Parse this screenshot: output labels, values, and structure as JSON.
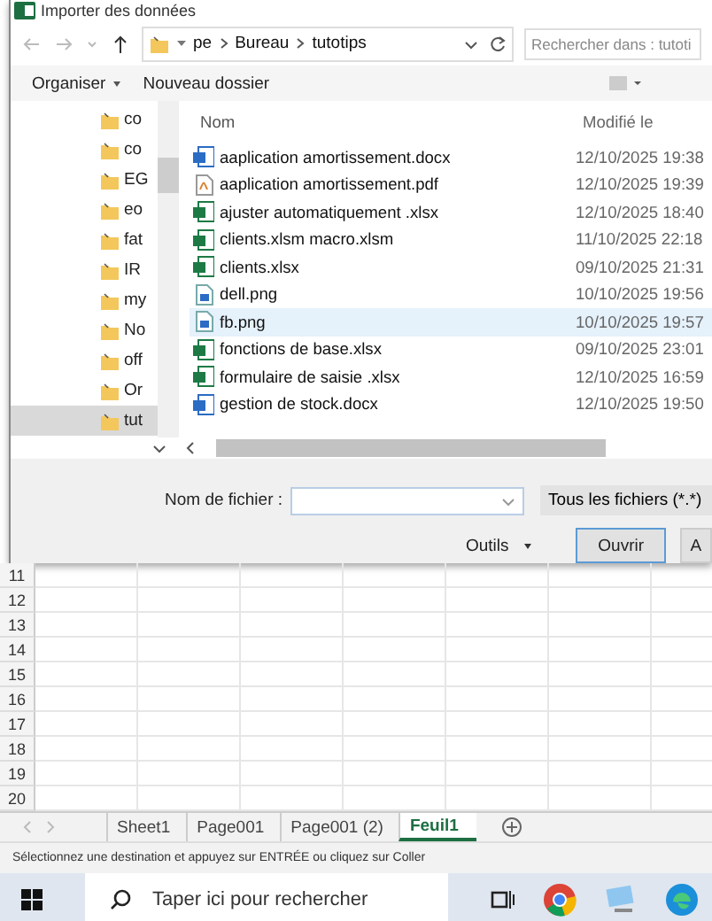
{
  "dialog": {
    "title": "Importer des données",
    "path": [
      "pe",
      "Bureau",
      "tutotips"
    ],
    "search": {
      "placeholder": "Rechercher dans : tutoti"
    },
    "toolbar": {
      "organize": "Organiser",
      "new_folder": "Nouveau dossier"
    },
    "nav_items": [
      {
        "label": "co",
        "selected": false
      },
      {
        "label": "co",
        "selected": false
      },
      {
        "label": "EG",
        "selected": false
      },
      {
        "label": "eo",
        "selected": false
      },
      {
        "label": "fat",
        "selected": false
      },
      {
        "label": "IR",
        "selected": false
      },
      {
        "label": "my",
        "selected": false
      },
      {
        "label": "No",
        "selected": false
      },
      {
        "label": "off",
        "selected": false
      },
      {
        "label": "Or",
        "selected": false
      },
      {
        "label": "tut",
        "selected": true
      }
    ],
    "columns": [
      "Nom",
      "Modifié le"
    ],
    "files": [
      {
        "name": "aaplication amortissement.docx",
        "modified": "12/10/2025 19:38",
        "kind": "word",
        "selected": false
      },
      {
        "name": "aaplication amortissement.pdf",
        "modified": "12/10/2025 19:39",
        "kind": "pdf",
        "selected": false
      },
      {
        "name": "ajuster automatiquement .xlsx",
        "modified": "12/10/2025 18:40",
        "kind": "excel",
        "selected": false
      },
      {
        "name": "clients.xlsm macro.xlsm",
        "modified": "11/10/2025 22:18",
        "kind": "excel",
        "selected": false
      },
      {
        "name": "clients.xlsx",
        "modified": "09/10/2025 21:31",
        "kind": "excel",
        "selected": false
      },
      {
        "name": "dell.png",
        "modified": "10/10/2025 19:56",
        "kind": "image",
        "selected": false
      },
      {
        "name": "fb.png",
        "modified": "10/10/2025 19:57",
        "kind": "image",
        "selected": true
      },
      {
        "name": "fonctions de base.xlsx",
        "modified": "09/10/2025 23:01",
        "kind": "excel",
        "selected": false
      },
      {
        "name": "formulaire de saisie .xlsx",
        "modified": "12/10/2025 16:59",
        "kind": "excel",
        "selected": false
      },
      {
        "name": "gestion de stock.docx",
        "modified": "12/10/2025 19:50",
        "kind": "word",
        "selected": false
      }
    ],
    "filename_label": "Nom de fichier :",
    "file_type": "Tous les fichiers (*.*)",
    "tools": "Outils",
    "open": "Ouvrir",
    "cancel": "A"
  },
  "sheet": {
    "rows": [
      "11",
      "12",
      "13",
      "14",
      "15",
      "16",
      "17",
      "18",
      "19",
      "20"
    ]
  },
  "sheet_tabs": [
    {
      "label": "Sheet1",
      "selected": false
    },
    {
      "label": "Page001",
      "selected": false
    },
    {
      "label": "Page001 (2)",
      "selected": false
    },
    {
      "label": "Feuil1",
      "selected": true
    }
  ],
  "status_bar": "Sélectionnez une destination et appuyez sur ENTRÉE ou cliquez sur Coller",
  "taskbar": {
    "search": {
      "placeholder": "Taper ici pour rechercher"
    }
  }
}
